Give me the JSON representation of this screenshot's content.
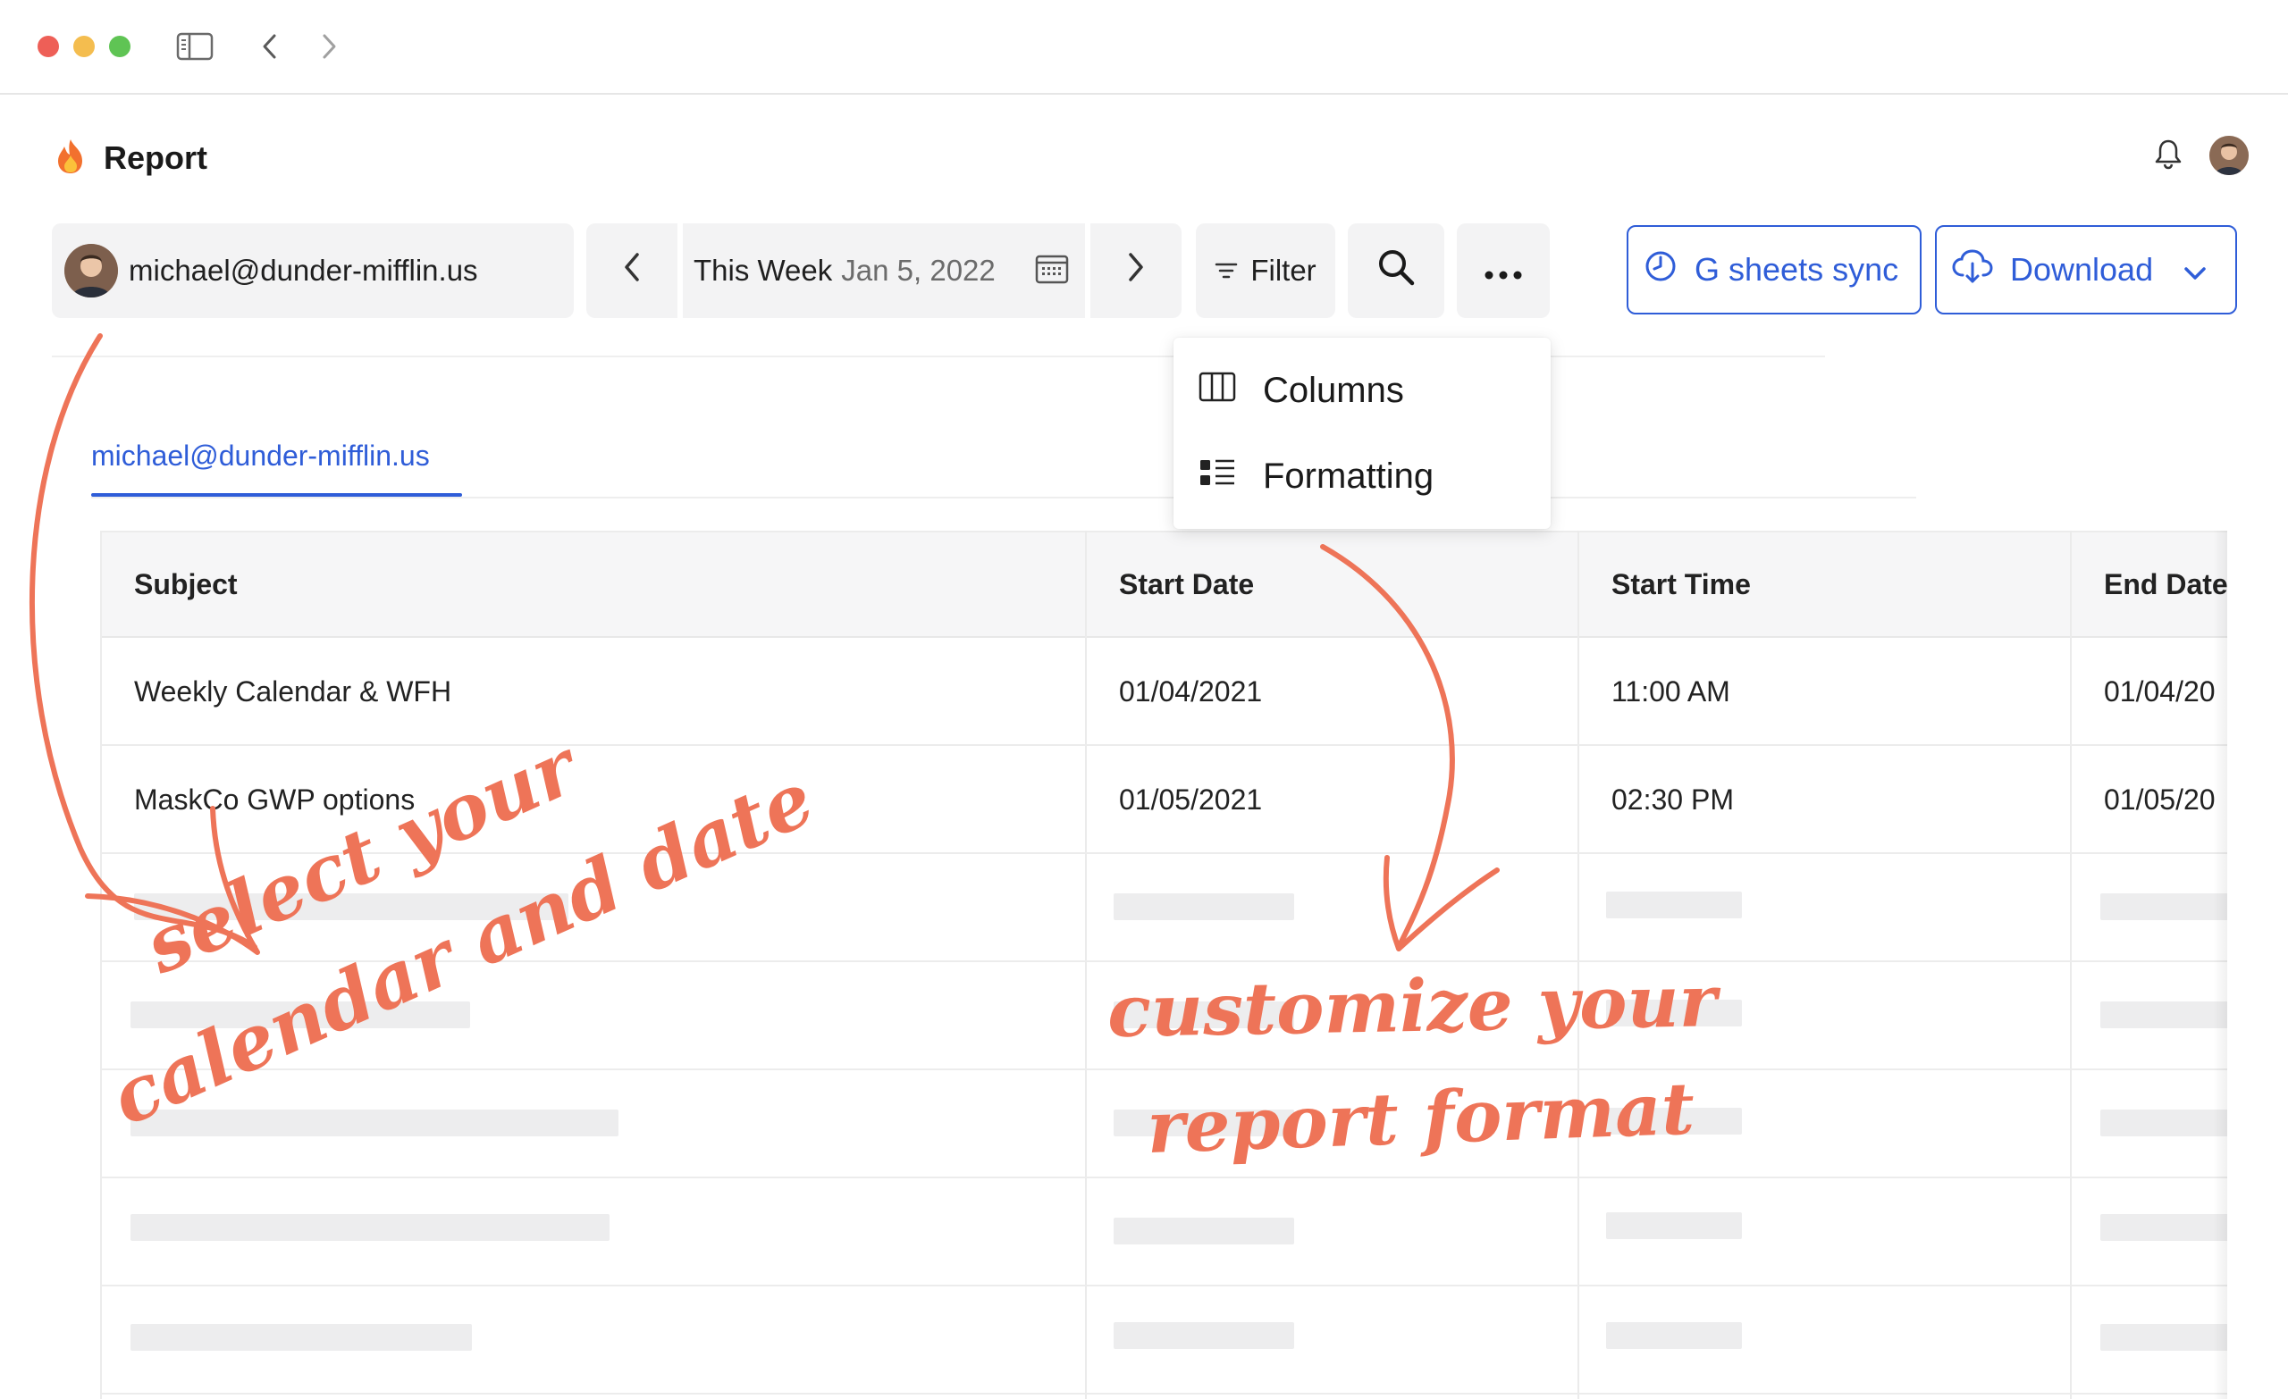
{
  "window": {
    "controls": [
      "close",
      "minimize",
      "maximize"
    ],
    "icons": [
      "sidebar-toggle-icon",
      "back-arrow-icon",
      "forward-arrow-icon"
    ]
  },
  "header": {
    "title_icon": "fire-icon",
    "title": "Report",
    "icons": [
      "bell-icon",
      "user-avatar"
    ]
  },
  "toolbar": {
    "account": "michael@dunder-mifflin.us",
    "date_range_label": "This Week",
    "date_value": "Jan 5, 2022",
    "filter_label": "Filter",
    "gsheets_label": "G sheets sync",
    "download_label": "Download",
    "accent_color": "#2f5dd8"
  },
  "tabs": [
    {
      "label": "michael@dunder-mifflin.us",
      "active": true
    }
  ],
  "menu": {
    "items": [
      {
        "label": "Columns",
        "icon": "columns-icon"
      },
      {
        "label": "Formatting",
        "icon": "formatting-icon"
      }
    ]
  },
  "table": {
    "columns": [
      "Subject",
      "Start Date",
      "Start Time",
      "End Date"
    ],
    "rows": [
      [
        "Weekly Calendar & WFH",
        "01/04/2021",
        "11:00 AM",
        "01/04/20"
      ],
      [
        "MaskCo GWP options",
        "01/05/2021",
        "02:30 PM",
        "01/05/20"
      ]
    ],
    "placeholder_rows": 5
  },
  "annotations": {
    "left_line1": "select your",
    "left_line2": "calendar and date",
    "right_line1": "customize your",
    "right_line2": "report format",
    "color": "#ee7458"
  }
}
